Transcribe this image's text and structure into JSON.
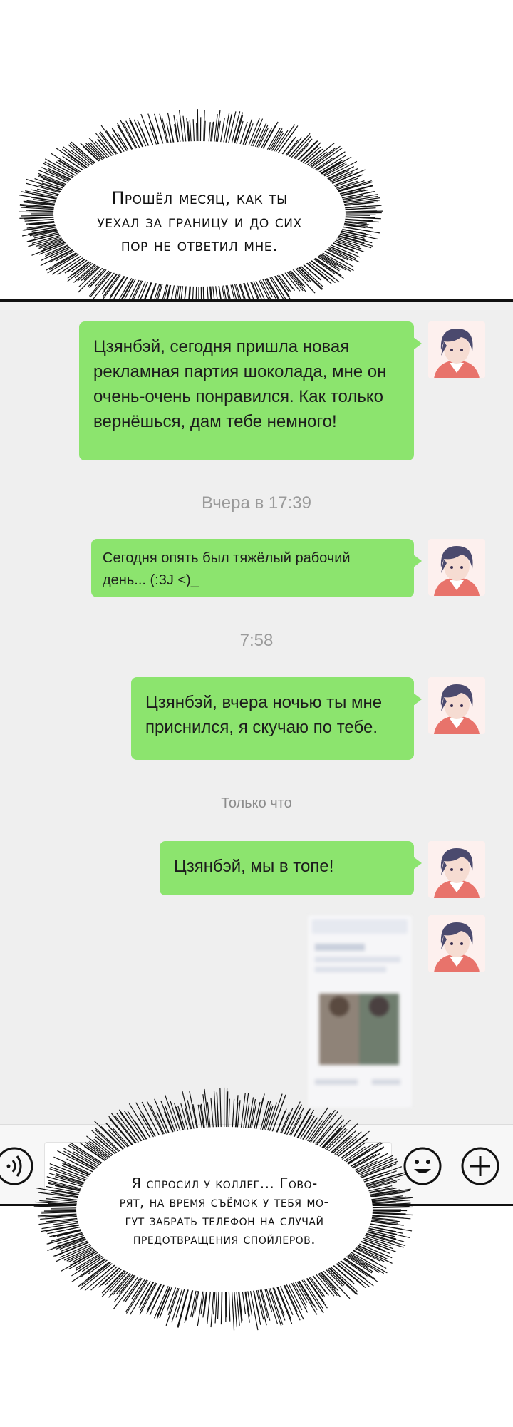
{
  "narration": {
    "top": {
      "lines": [
        "Прошёл месяц, как ты",
        "уехал за границу и до сих",
        "пор не ответил мне."
      ]
    },
    "bottom": {
      "lines": [
        "Я спросил у коллег... Гово-",
        "рят, на время съёмок у тебя мо-",
        "гут забрать телефон на случай",
        "предотвращения спойлеров."
      ]
    }
  },
  "chat": {
    "messages": [
      {
        "type": "text",
        "lines": [
          "Цзянбэй, сегодня пришла новая",
          "рекламная партия шоколада, мне он",
          "очень-очень понравился. Как только",
          "вернёшься, дам тебе немного!"
        ]
      },
      {
        "type": "timestamp",
        "text": "Вчера в 17:39"
      },
      {
        "type": "text",
        "lines": [
          "Сегодня опять был тяжёлый рабочий",
          "день... (:3J <)_"
        ]
      },
      {
        "type": "timestamp",
        "text": "7:58"
      },
      {
        "type": "text",
        "lines": [
          "Цзянбэй, вчера ночью ты мне",
          "приснился, я скучаю по тебе."
        ]
      },
      {
        "type": "timestamp",
        "text": "Только что"
      },
      {
        "type": "text",
        "lines": [
          "Цзянбэй, мы в топе!"
        ]
      },
      {
        "type": "image",
        "description_icon": "blurred-screenshot-image"
      }
    ]
  },
  "input_bar": {
    "voice_icon": "voice-icon",
    "emoji_icon": "emoji-icon",
    "add_icon": "plus-circle-icon"
  },
  "colors": {
    "bubble": "#8ce46e",
    "chat_background": "#efefef",
    "timestamp": "#9a9a9a"
  }
}
